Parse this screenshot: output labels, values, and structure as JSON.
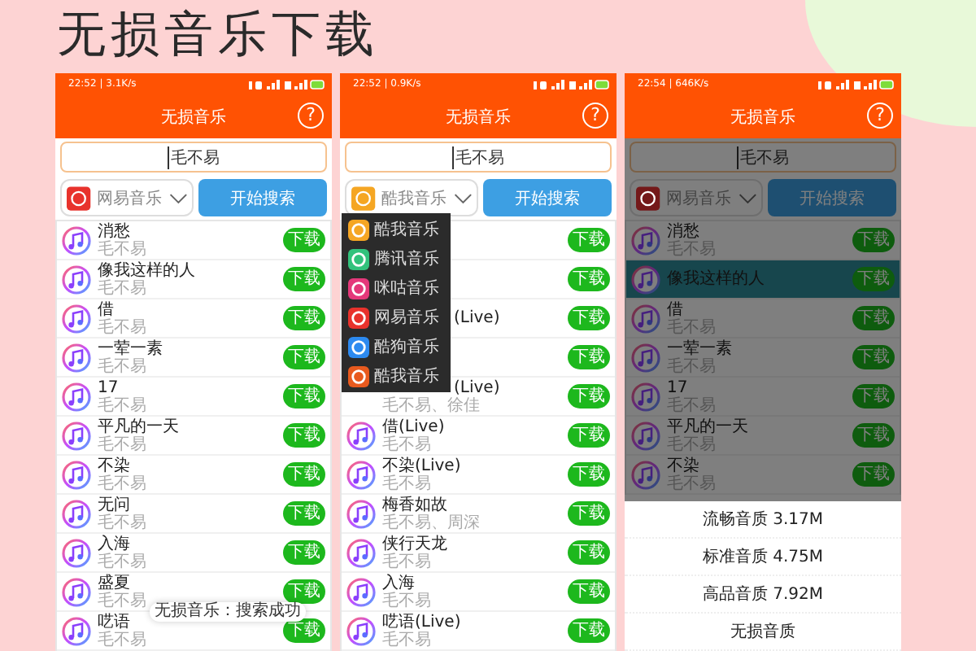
{
  "heading": "无损音乐下载",
  "phones": [
    {
      "status": "22:52 | 3.1K/s",
      "app_bar": {
        "title": "无损音乐",
        "help": "?"
      },
      "search": {
        "value": "毛不易"
      },
      "source": {
        "label": "网易音乐",
        "color": "#e8322c"
      },
      "search_button": "开始搜索",
      "songs": [
        {
          "title": "消愁",
          "artist": "毛不易",
          "button": "下载"
        },
        {
          "title": "像我这样的人",
          "artist": "毛不易",
          "button": "下载"
        },
        {
          "title": "借",
          "artist": "毛不易",
          "button": "下载"
        },
        {
          "title": "一荤一素",
          "artist": "毛不易",
          "button": "下载"
        },
        {
          "title": "17",
          "artist": "毛不易",
          "button": "下载"
        },
        {
          "title": "平凡的一天",
          "artist": "毛不易",
          "button": "下载"
        },
        {
          "title": "不染",
          "artist": "毛不易",
          "button": "下载"
        },
        {
          "title": "无问",
          "artist": "毛不易",
          "button": "下载"
        },
        {
          "title": "入海",
          "artist": "毛不易",
          "button": "下载"
        },
        {
          "title": "盛夏",
          "artist": "毛不易",
          "button": "下载"
        },
        {
          "title": "呓语",
          "artist": "毛不易",
          "button": "下载"
        }
      ],
      "toast": "无损音乐：搜索成功"
    },
    {
      "status": "22:52 | 0.9K/s",
      "app_bar": {
        "title": "无损音乐",
        "help": "?"
      },
      "search": {
        "value": "毛不易"
      },
      "source": {
        "label": "酷我音乐",
        "color": "#f5a623"
      },
      "search_button": "开始搜索",
      "dropdown": [
        {
          "label": "酷我音乐",
          "color": "#f5a623"
        },
        {
          "label": "腾讯音乐",
          "color": "#31c27c"
        },
        {
          "label": "咪咕音乐",
          "color": "#e4387a"
        },
        {
          "label": "网易音乐",
          "color": "#e8322c"
        },
        {
          "label": "酷狗音乐",
          "color": "#2c8af0"
        },
        {
          "label": "酷我音乐",
          "color": "#e85a1e"
        }
      ],
      "songs": [
        {
          "button": "下载"
        },
        {
          "button": "下载"
        },
        {
          "title": "(Live)",
          "button": "下载",
          "covered": true
        },
        {
          "button": "下载"
        },
        {
          "title": "(Live)",
          "artist": "毛不易、徐佳",
          "button": "下载",
          "covered": true
        },
        {
          "title": "借(Live)",
          "artist": "毛不易",
          "button": "下载",
          "covered": false
        },
        {
          "title": "不染(Live)",
          "artist": "毛不易",
          "button": "下载",
          "covered": false
        },
        {
          "title": "梅香如故",
          "artist": "毛不易、周深",
          "button": "下载",
          "covered": false
        },
        {
          "title": "侠行天龙",
          "artist": "毛不易",
          "button": "下载",
          "covered": false
        },
        {
          "title": "入海",
          "artist": "毛不易",
          "button": "下载",
          "covered": false
        },
        {
          "title": "呓语(Live)",
          "artist": "毛不易",
          "button": "下载",
          "covered": false
        }
      ]
    },
    {
      "status": "22:54 | 646K/s",
      "app_bar": {
        "title": "无损音乐",
        "help": "?"
      },
      "search": {
        "value": "毛不易"
      },
      "source": {
        "label": "网易音乐",
        "color": "#74191a"
      },
      "search_button": "开始搜索",
      "dimmed": true,
      "songs": [
        {
          "title": "消愁",
          "artist": "毛不易",
          "button": "下载",
          "selected": false
        },
        {
          "title": "像我这样的人",
          "button": "下载",
          "selected": true
        },
        {
          "title": "借",
          "artist": "毛不易",
          "button": "下载",
          "selected": false
        },
        {
          "title": "一荤一素",
          "artist": "毛不易",
          "button": "下载",
          "selected": false
        },
        {
          "title": "17",
          "artist": "毛不易",
          "button": "下载",
          "selected": false
        },
        {
          "title": "平凡的一天",
          "artist": "毛不易",
          "button": "下载",
          "selected": false
        },
        {
          "title": "不染",
          "artist": "毛不易",
          "button": "下载",
          "selected": false
        }
      ],
      "quality_options": [
        "流畅音质 3.17M",
        "标准音质 4.75M",
        "高品音质 7.92M",
        "无损音质"
      ]
    }
  ]
}
